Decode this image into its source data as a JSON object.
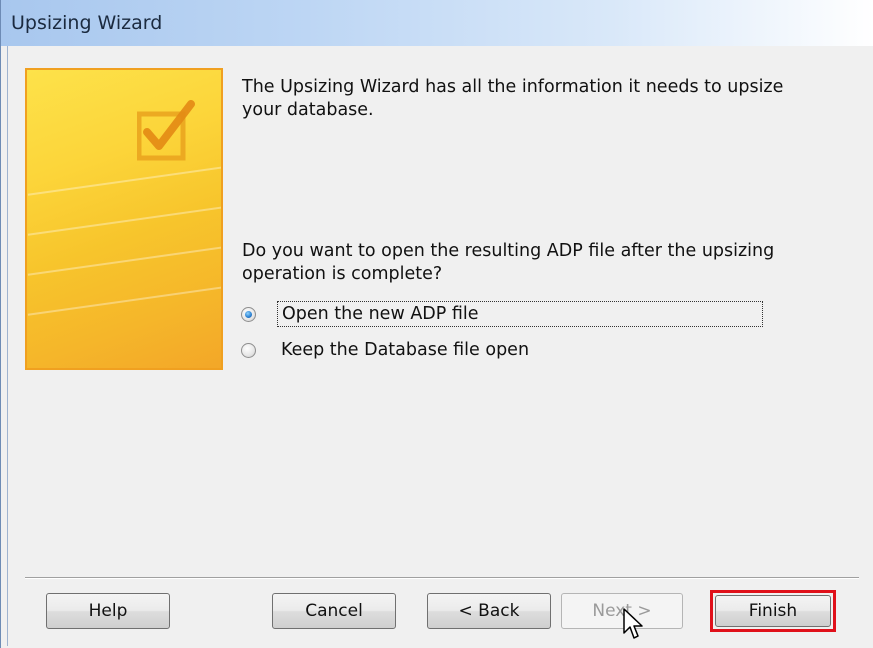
{
  "window": {
    "title": "Upsizing Wizard"
  },
  "content": {
    "info_message": "The Upsizing Wizard has all the information it needs to upsize your database.",
    "question": "Do you want to open the resulting ADP file after the upsizing operation is complete?",
    "options": [
      {
        "label": "Open the new ADP file",
        "checked": true
      },
      {
        "label": "Keep the Database file open",
        "checked": false
      }
    ]
  },
  "buttons": {
    "help": "Help",
    "cancel": "Cancel",
    "back": "< Back",
    "next": "Next >",
    "finish": "Finish"
  },
  "colors": {
    "accent_highlight": "#e0101a",
    "art_border": "#f0a020",
    "radio_selected": "#2a7fd0"
  }
}
